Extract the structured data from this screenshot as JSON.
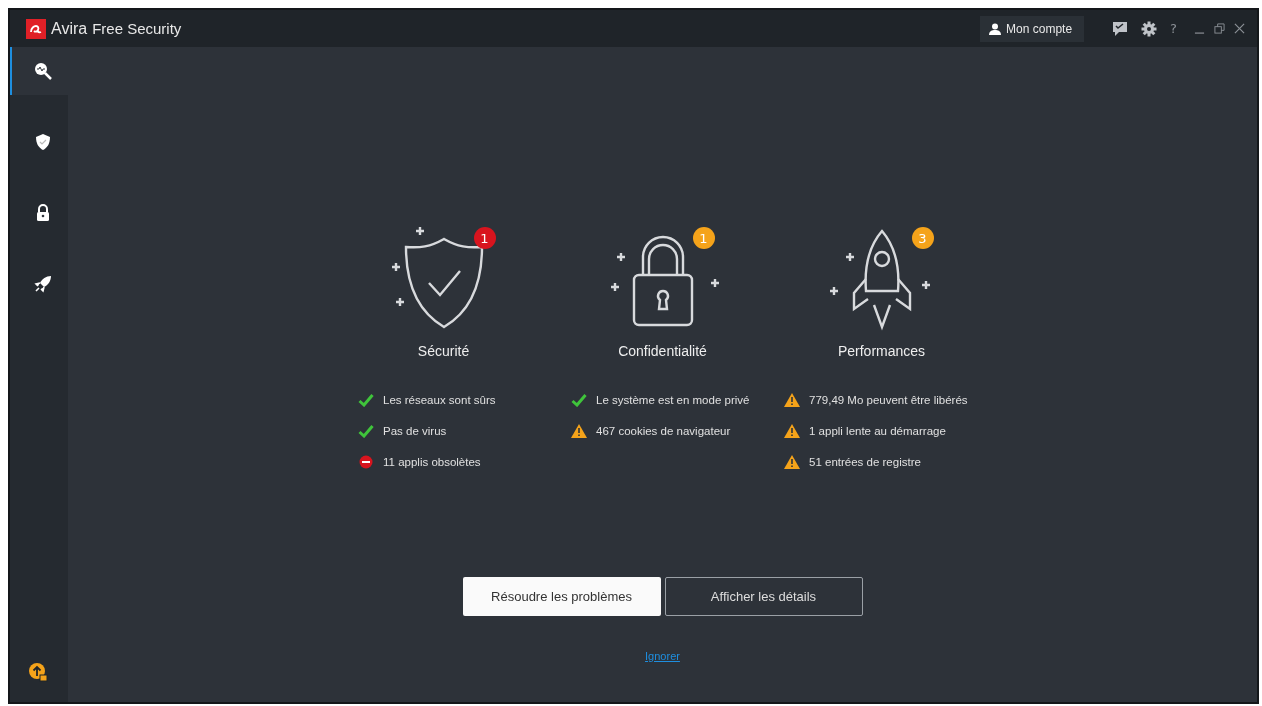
{
  "window": {
    "brand": "Avira",
    "title": "Free Security",
    "account_button": "Mon compte",
    "help": "?"
  },
  "sidebar": {
    "items": [
      {
        "kind": "scan",
        "selected": true
      },
      {
        "kind": "shield",
        "selected": false
      },
      {
        "kind": "lock",
        "selected": false
      },
      {
        "kind": "rocket",
        "selected": false
      }
    ]
  },
  "categories": [
    {
      "kind": "shield",
      "title": "Sécurité",
      "badge": "1",
      "color": "#d8141e",
      "items": [
        {
          "kind": "ok",
          "text": "Les réseaux sont sûrs"
        },
        {
          "kind": "ok",
          "text": "Pas de virus"
        },
        {
          "kind": "error",
          "text": "11 applis obsolètes"
        }
      ]
    },
    {
      "kind": "lock",
      "title": "Confidentialité",
      "badge": "1",
      "color": "#f5a31a",
      "items": [
        {
          "kind": "ok",
          "text": "Le système est en mode privé"
        },
        {
          "kind": "warning",
          "text": "467 cookies de navigateur"
        }
      ]
    },
    {
      "kind": "rocket",
      "title": "Performances",
      "badge": "3",
      "color": "#f5a31a",
      "items": [
        {
          "kind": "warning",
          "text": "779,49 Mo peuvent être libérés"
        },
        {
          "kind": "warning",
          "text": "1 appli lente au démarrage"
        },
        {
          "kind": "warning",
          "text": "51 entrées de registre"
        }
      ]
    }
  ],
  "buttons": [
    {
      "kind": "primary",
      "label": "Résoudre les problèmes"
    },
    {
      "kind": "secondary",
      "label": "Afficher les détails"
    }
  ],
  "link": "Ignorer"
}
